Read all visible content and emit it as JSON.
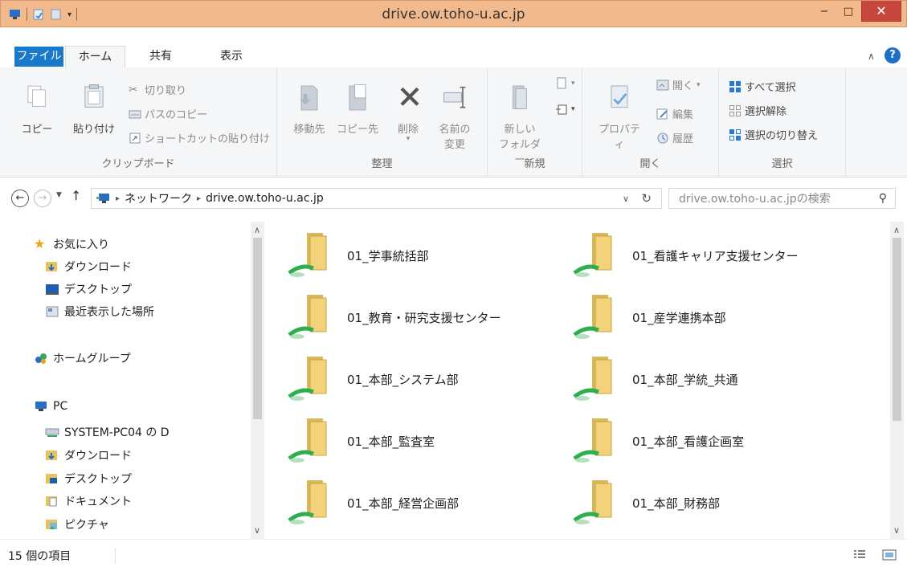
{
  "window": {
    "title": "drive.ow.toho-u.ac.jp",
    "minimize": "−",
    "maximize": "□",
    "close": "✕"
  },
  "tabs": {
    "file": "ファイル",
    "home": "ホーム",
    "share": "共有",
    "view": "表示"
  },
  "ribbon": {
    "clipboard": {
      "label": "クリップボード",
      "copy": "コピー",
      "paste": "貼り付け",
      "cut": "切り取り",
      "copy_path": "パスのコピー",
      "paste_shortcut": "ショートカットの貼り付け"
    },
    "organize": {
      "label": "整理",
      "move_to": "移動先",
      "copy_to": "コピー先",
      "delete": "削除",
      "rename_line1": "名前の",
      "rename_line2": "変更"
    },
    "new": {
      "label": "新規",
      "new_folder_line1": "新しい",
      "new_folder_line2": "フォルダー"
    },
    "open": {
      "label": "開く",
      "properties": "プロパティ",
      "open": "開く",
      "edit": "編集",
      "history": "履歴"
    },
    "select": {
      "label": "選択",
      "select_all": "すべて選択",
      "select_none": "選択解除",
      "invert": "選択の切り替え"
    }
  },
  "address": {
    "crumbs": [
      "ネットワーク",
      "drive.ow.toho-u.ac.jp"
    ],
    "search_placeholder": "drive.ow.toho-u.ac.jpの検索"
  },
  "navpane": {
    "favorites": "お気に入り",
    "fav_downloads": "ダウンロード",
    "fav_desktop": "デスクトップ",
    "fav_recent": "最近表示した場所",
    "homegroup": "ホームグループ",
    "pc": "PC",
    "system_drive": "SYSTEM-PC04 の D",
    "pc_downloads": "ダウンロード",
    "pc_desktop": "デスクトップ",
    "pc_documents": "ドキュメント",
    "pc_pictures": "ピクチャ"
  },
  "folders": [
    "01_学事統括部",
    "01_看護キャリア支援センター",
    "01_教育・研究支援センター",
    "01_産学連携本部",
    "01_本部_システム部",
    "01_本部_学統_共通",
    "01_本部_監査室",
    "01_本部_看護企画室",
    "01_本部_経営企画部",
    "01_本部_財務部"
  ],
  "status": {
    "item_count": "15 個の項目"
  },
  "colors": {
    "titlebar": "#f2b98c",
    "file_tab": "#1979ca",
    "close_button": "#c7463d",
    "folder_yellow": "#f2d27a",
    "network_cable": "#2fae4e"
  }
}
